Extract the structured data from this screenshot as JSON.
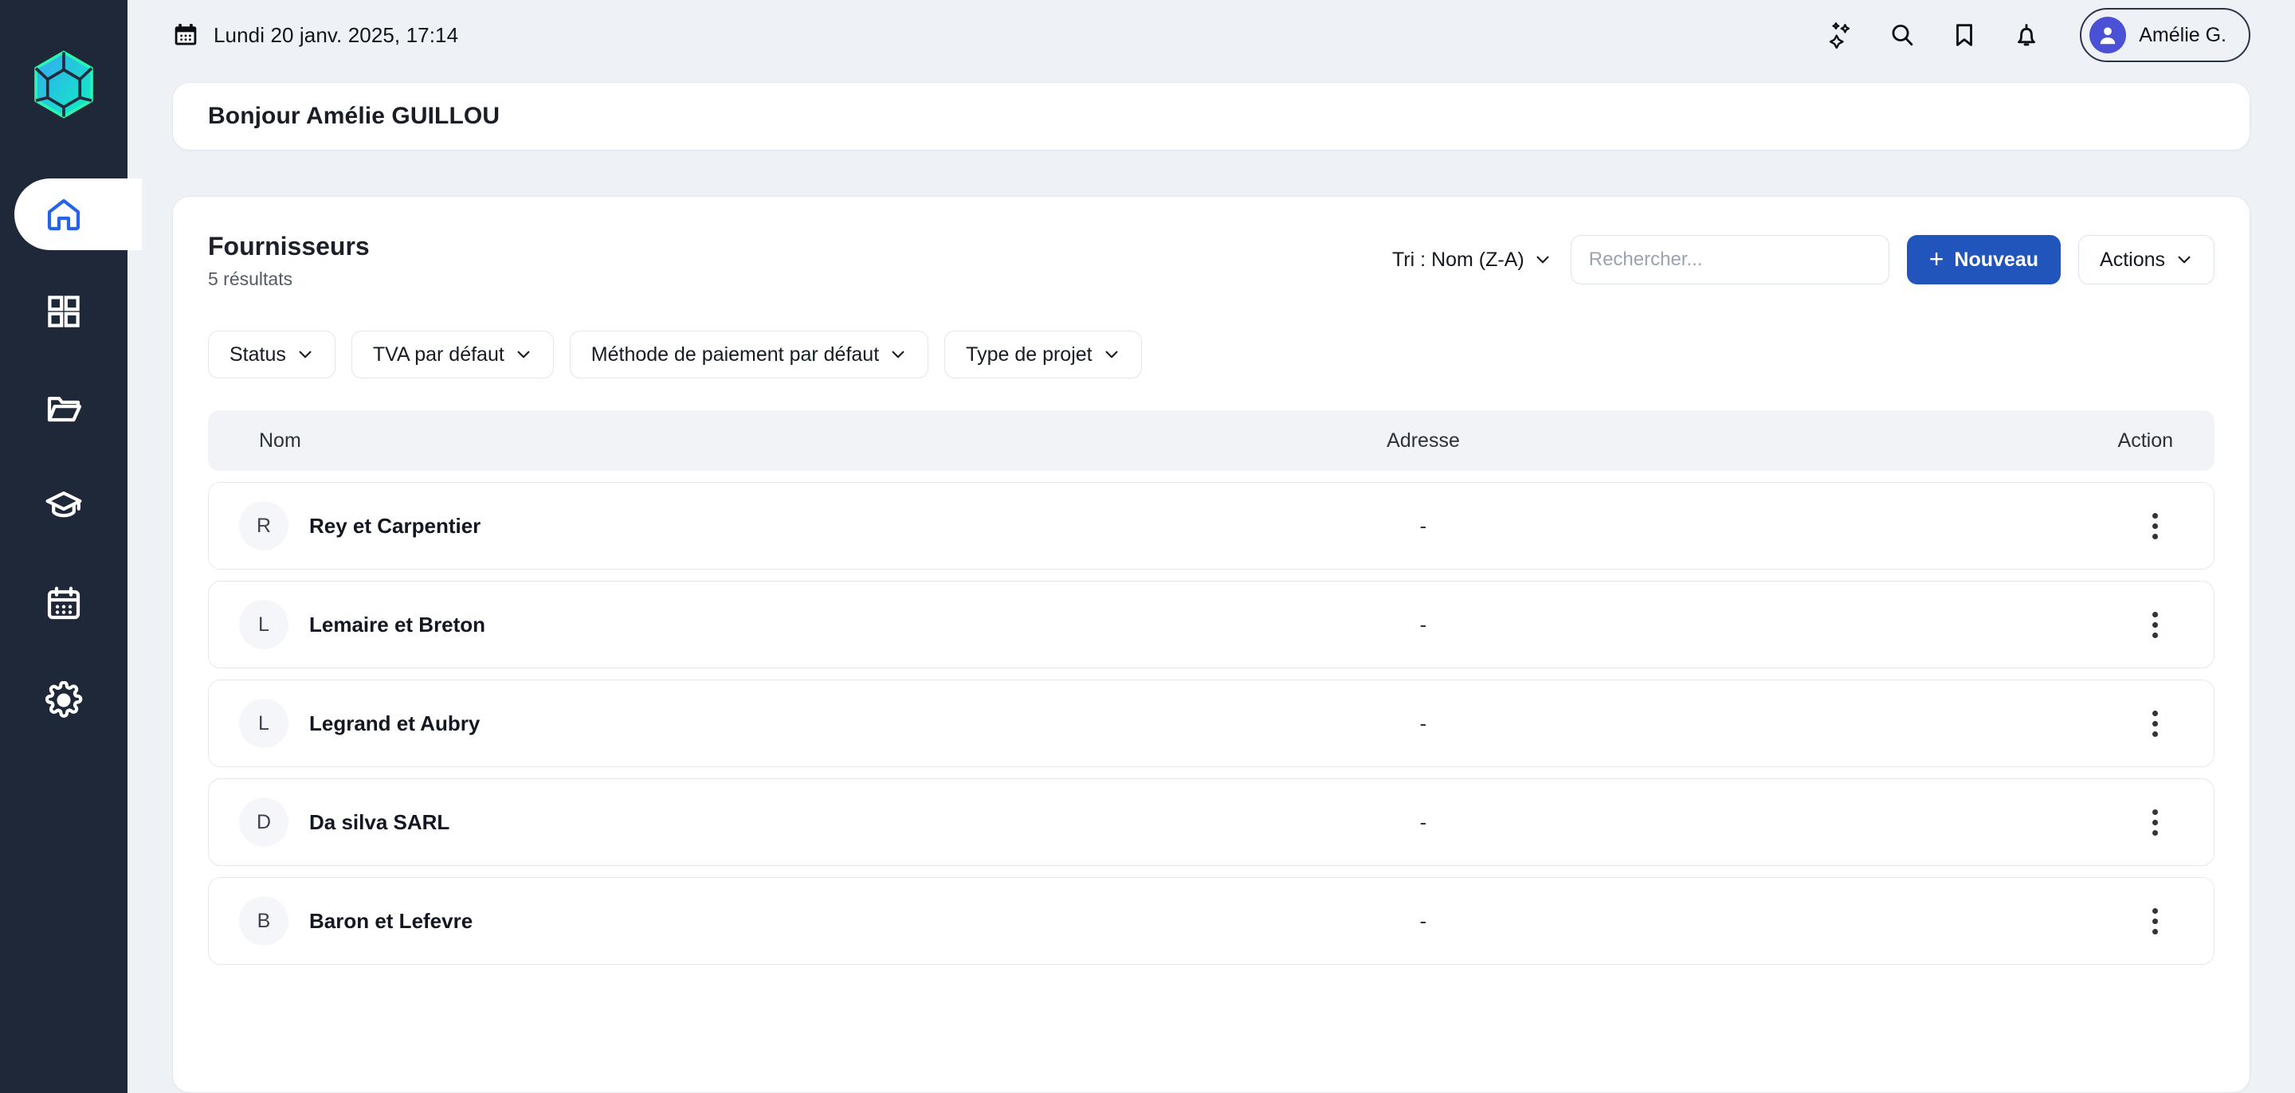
{
  "sidebar": {
    "logo_name": "cube-logo",
    "items": [
      {
        "id": "home",
        "icon": "home-icon",
        "active": true
      },
      {
        "id": "dashboard",
        "icon": "grid-icon",
        "active": false
      },
      {
        "id": "files",
        "icon": "folder-icon",
        "active": false
      },
      {
        "id": "training",
        "icon": "graduation-cap-icon",
        "active": false
      },
      {
        "id": "calendar",
        "icon": "calendar-icon",
        "active": false
      },
      {
        "id": "settings",
        "icon": "gear-icon",
        "active": false
      }
    ]
  },
  "topbar": {
    "date": "Lundi 20 janv. 2025, 17:14",
    "icons": [
      "sparkles-icon",
      "search-icon",
      "bookmark-icon",
      "bell-icon"
    ],
    "user": {
      "name": "Amélie G.",
      "avatar_color": "#4a51d4"
    }
  },
  "greeting": {
    "title": "Bonjour Amélie GUILLOU"
  },
  "list": {
    "title": "Fournisseurs",
    "results_label": "5 résultats",
    "sort_label": "Tri : Nom (Z-A)",
    "search_placeholder": "Rechercher...",
    "search_value": "",
    "new_label": "Nouveau",
    "actions_label": "Actions",
    "filters": [
      {
        "label": "Status"
      },
      {
        "label": "TVA par défaut"
      },
      {
        "label": "Méthode de paiement par défaut"
      },
      {
        "label": "Type de projet"
      }
    ],
    "columns": {
      "name": "Nom",
      "address": "Adresse",
      "action": "Action"
    },
    "rows": [
      {
        "initial": "R",
        "name": "Rey et Carpentier",
        "address": "-"
      },
      {
        "initial": "L",
        "name": "Lemaire et Breton",
        "address": "-"
      },
      {
        "initial": "L",
        "name": "Legrand et Aubry",
        "address": "-"
      },
      {
        "initial": "D",
        "name": "Da silva SARL",
        "address": "-"
      },
      {
        "initial": "B",
        "name": "Baron et Lefevre",
        "address": "-"
      }
    ]
  },
  "colors": {
    "sidebar_bg": "#1e2838",
    "page_bg": "#eef1f6",
    "primary": "#2255bb",
    "active_nav": "#2563eb"
  }
}
